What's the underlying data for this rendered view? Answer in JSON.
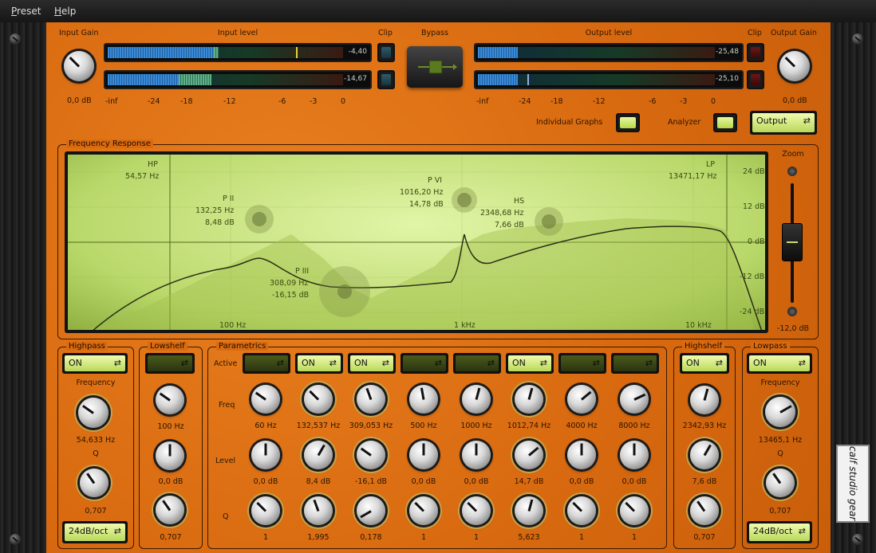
{
  "menu": {
    "preset": "Preset",
    "preset_key": "P",
    "preset_rest": "reset",
    "help": "Help",
    "help_key": "H",
    "help_rest": "elp"
  },
  "top": {
    "input_gain_label": "Input Gain",
    "input_gain_value": "0,0 dB",
    "input_level_label": "Input level",
    "input_meter_1": "-4,40",
    "input_meter_2": "-14,67",
    "input_meter_1_level": 0.75,
    "input_meter_2_level": 0.43,
    "clip_label": "Clip",
    "bypass_label": "Bypass",
    "output_level_label": "Output level",
    "output_meter_1": "-25,48",
    "output_meter_2": "-25,10",
    "output_gain_label": "Output Gain",
    "output_gain_value": "0,0 dB",
    "scale_in": [
      "-inf",
      "-24",
      "-18",
      "-12",
      "-6",
      "-3",
      "0"
    ],
    "scale_out": [
      "-inf",
      "-24",
      "-18",
      "-12",
      "-6",
      "-3",
      "0"
    ],
    "individual_graphs_label": "Individual Graphs",
    "analyzer_label": "Analyzer",
    "output_select": "Output"
  },
  "freq": {
    "title": "Frequency Response",
    "zoom_label": "Zoom",
    "zoom_value": "-12,0 dB",
    "db_ticks": [
      "24 dB",
      "12 dB",
      "0 dB",
      "-12 dB",
      "-24 dB"
    ],
    "freq_ticks": [
      "100 Hz",
      "1 kHz",
      "10 kHz"
    ],
    "bands": [
      {
        "name": "HP",
        "freq": "54,57 Hz"
      },
      {
        "name": "P II",
        "freq": "132,25 Hz",
        "gain": "8,48 dB"
      },
      {
        "name": "P III",
        "freq": "308,09 Hz",
        "gain": "-16,15 dB"
      },
      {
        "name": "P VI",
        "freq": "1016,20 Hz",
        "gain": "14,78 dB"
      },
      {
        "name": "HS",
        "freq": "2348,68 Hz",
        "gain": "7,66 dB"
      },
      {
        "name": "LP",
        "freq": "13471,17 Hz"
      }
    ]
  },
  "highpass": {
    "title": "Highpass",
    "toggle": "ON",
    "freq_label": "Frequency",
    "freq": "54,633 Hz",
    "q_label": "Q",
    "q": "0,707",
    "slope": "24dB/oct"
  },
  "lowshelf": {
    "title": "Lowshelf",
    "toggle": "",
    "freq": "100 Hz",
    "level": "0,0 dB",
    "q": "0,707"
  },
  "parametrics": {
    "title": "Parametrics",
    "active_label": "Active",
    "freq_label": "Freq",
    "level_label": "Level",
    "q_label": "Q",
    "bands": [
      {
        "toggle": "",
        "freq": "60 Hz",
        "level": "0,0 dB",
        "q": "1"
      },
      {
        "toggle": "ON",
        "freq": "132,537 Hz",
        "level": "8,4 dB",
        "q": "1,995"
      },
      {
        "toggle": "ON",
        "freq": "309,053 Hz",
        "level": "-16,1 dB",
        "q": "0,178"
      },
      {
        "toggle": "",
        "freq": "500 Hz",
        "level": "0,0 dB",
        "q": "1"
      },
      {
        "toggle": "",
        "freq": "1000 Hz",
        "level": "0,0 dB",
        "q": "1"
      },
      {
        "toggle": "ON",
        "freq": "1012,74 Hz",
        "level": "14,7 dB",
        "q": "5,623"
      },
      {
        "toggle": "",
        "freq": "4000 Hz",
        "level": "0,0 dB",
        "q": "1"
      },
      {
        "toggle": "",
        "freq": "8000 Hz",
        "level": "0,0 dB",
        "q": "1"
      }
    ]
  },
  "highshelf": {
    "title": "Highshelf",
    "toggle": "ON",
    "freq": "2342,93 Hz",
    "level": "7,6 dB",
    "q": "0,707"
  },
  "lowpass": {
    "title": "Lowpass",
    "toggle": "ON",
    "freq_label": "Frequency",
    "freq": "13465,1 Hz",
    "q_label": "Q",
    "q": "0,707",
    "slope": "24dB/oct"
  },
  "logo": "calf studio gear"
}
